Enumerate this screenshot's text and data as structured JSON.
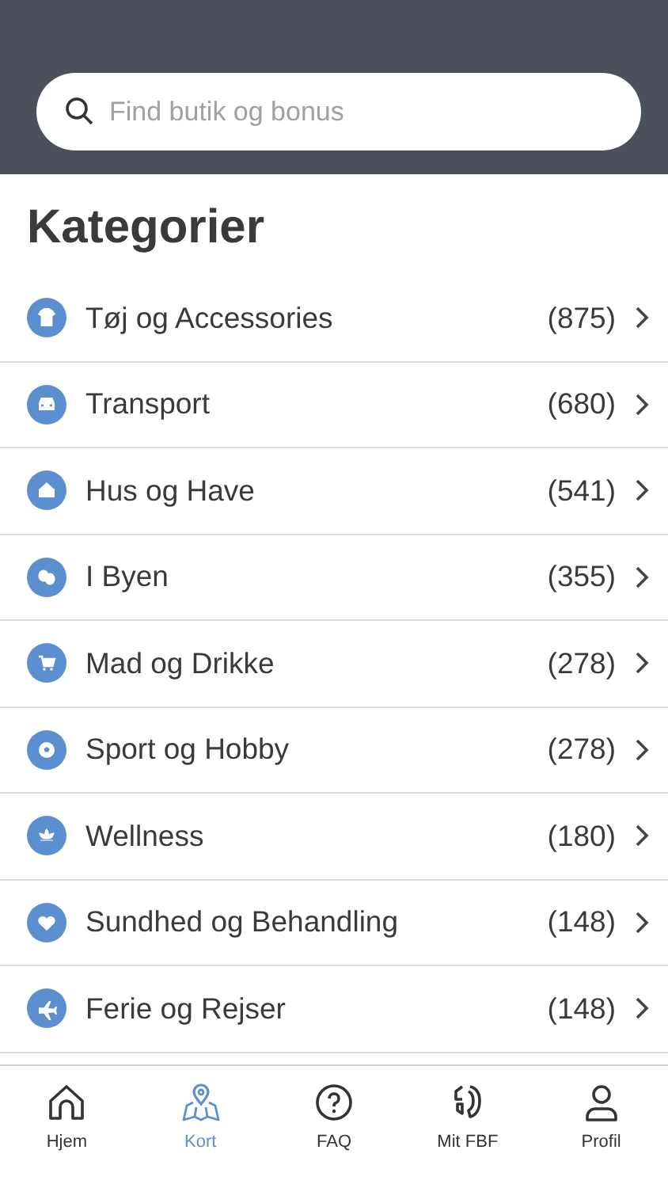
{
  "search": {
    "placeholder": "Find butik og bonus"
  },
  "title": "Kategorier",
  "categories": [
    {
      "label": "Tøj og Accessories",
      "count": "(875)"
    },
    {
      "label": "Transport",
      "count": "(680)"
    },
    {
      "label": "Hus og Have",
      "count": "(541)"
    },
    {
      "label": "I Byen",
      "count": "(355)"
    },
    {
      "label": "Mad og Drikke",
      "count": "(278)"
    },
    {
      "label": "Sport og Hobby",
      "count": "(278)"
    },
    {
      "label": "Wellness",
      "count": "(180)"
    },
    {
      "label": "Sundhed og Behandling",
      "count": "(148)"
    },
    {
      "label": "Ferie og Rejser",
      "count": "(148)"
    }
  ],
  "tabs": [
    {
      "label": "Hjem",
      "selected": false
    },
    {
      "label": "Kort",
      "selected": true
    },
    {
      "label": "FAQ",
      "selected": false
    },
    {
      "label": "Mit FBF",
      "selected": false
    },
    {
      "label": "Profil",
      "selected": false
    }
  ]
}
